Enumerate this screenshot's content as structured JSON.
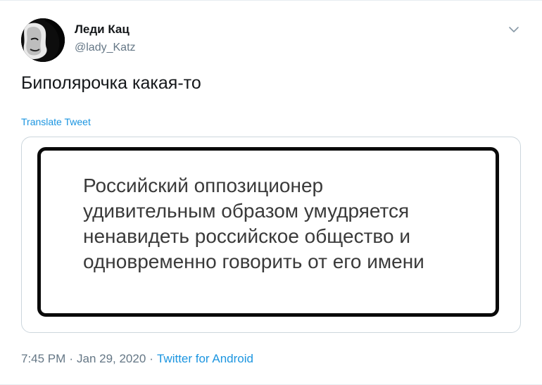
{
  "user": {
    "display_name": "Леди Кац",
    "handle": "@lady_Katz",
    "avatar_icon": "avatar-profile-photo"
  },
  "header": {
    "menu_icon": "chevron-down-icon"
  },
  "tweet": {
    "text": "Биполярочка какая-то",
    "translate_label": "Translate Tweet"
  },
  "media": {
    "quote_lines": [
      "Российский оппозиционер",
      "удивительным образом умудряется",
      "ненавидеть российское общество и",
      "одновременно говорить от его имени"
    ]
  },
  "meta": {
    "time": "7:45 PM",
    "separator": "·",
    "date": "Jan 29, 2020",
    "source": "Twitter for Android"
  },
  "colors": {
    "link": "#1b95e0",
    "secondary_text": "#657786",
    "border": "#ccd6dd"
  }
}
